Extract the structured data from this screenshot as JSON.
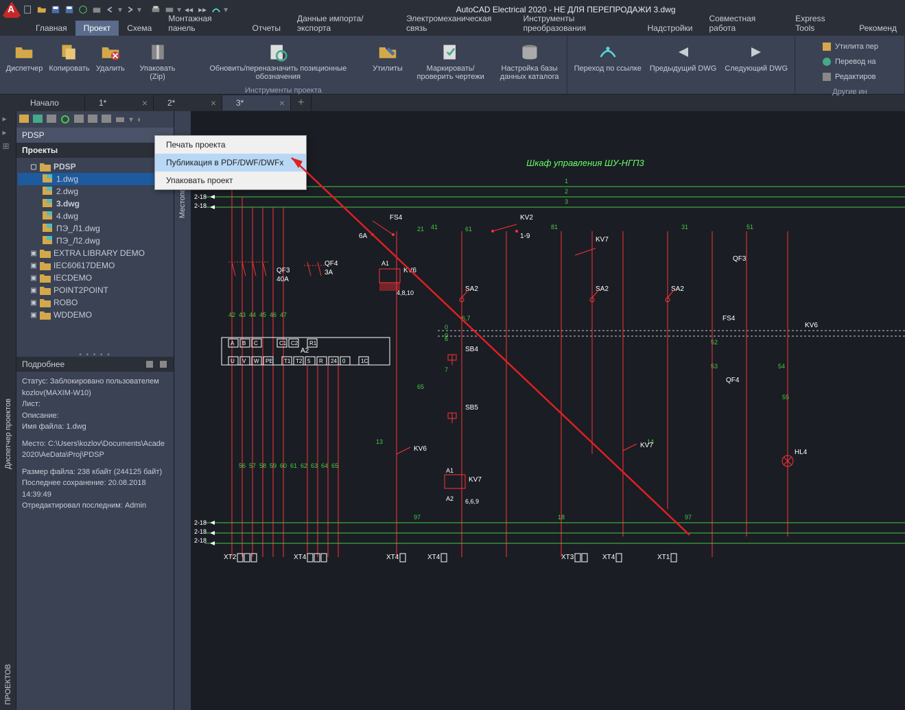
{
  "title": "AutoCAD Electrical 2020 - НЕ ДЛЯ ПЕРЕПРОДАЖИ   3.dwg",
  "ribbon_tabs": [
    "Главная",
    "Проект",
    "Схема",
    "Монтажная панель",
    "Отчеты",
    "Данные импорта/экспорта",
    "Электромеханическая связь",
    "Инструменты преобразования",
    "Надстройки",
    "Совместная работа",
    "Express Tools",
    "Рекоменд"
  ],
  "active_ribbon_tab": 1,
  "ribbon": {
    "dispetcher": "Диспетчер",
    "copy": "Копировать",
    "delete": "Удалить",
    "zip": "Упаковать (Zip)",
    "update": "Обновить/переназначить позиционные обозначения",
    "utilities": "Утилиты",
    "mark": "Маркировать/проверить чертежи",
    "catalog": "Настройка базы данных каталога",
    "goto_link": "Переход по ссылке",
    "prev_dwg": "Предыдущий DWG",
    "next_dwg": "Следующий DWG",
    "group1": "Инструменты проекта",
    "util_conv": "Утилита пер",
    "translate": "Перевод на",
    "edit_lang": "Редактиров",
    "other_group": "Другие ин"
  },
  "doc_tabs": [
    {
      "label": "Начало",
      "close": false
    },
    {
      "label": "1*",
      "close": true
    },
    {
      "label": "2*",
      "close": true
    },
    {
      "label": "3*",
      "close": true,
      "active": true
    }
  ],
  "project_panel": {
    "pdsp": "PDSP",
    "projects_header": "Проекты",
    "tree": {
      "root": "PDSP",
      "files": [
        "1.dwg",
        "2.dwg",
        "3.dwg",
        "4.dwg",
        "ПЭ_Л1.dwg",
        "ПЭ_Л2.dwg"
      ],
      "selected": 0,
      "bold": 2,
      "others": [
        "EXTRA LIBRARY DEMO",
        "IEC60617DEMO",
        "IECDEMO",
        "POINT2POINT",
        "ROBO",
        "WDDEMO"
      ]
    },
    "details_header": "Подробнее",
    "details": {
      "l1": "Статус: Заблокировано пользователем kozlov(MAXIM-W10)",
      "l2": "Лист:",
      "l3": "Описание:",
      "l4": "Имя файла: 1.dwg",
      "l5": "Место: C:\\Users\\kozlov\\Documents\\Acade 2020\\AeData\\Proj\\PDSP",
      "l6": "Размер файла: 238 кбайт (244125 байт)",
      "l7": "Последнее сохранение: 20.08.2018 14:39:49",
      "l8": "Отредактировал последним: Admin"
    }
  },
  "context_menu": {
    "items": [
      "Печать проекта",
      "Публикация в PDF/DWF/DWFx",
      "Упаковать проект"
    ],
    "highlighted": 1
  },
  "side_label_left": "Диспетчер проектов",
  "canvas_rail_label": "Местоположение",
  "side_label_bottom": "ПРОЕКТОВ",
  "canvas": {
    "title": "Шкаф управления ШУ-НГП3",
    "terminals_row1": [
      "A",
      "B",
      "C",
      "",
      "",
      "C1",
      "C2",
      "",
      "R1"
    ],
    "terminals_row2": [
      "U",
      "V",
      "W",
      "PE",
      "",
      "T1",
      "T2",
      "5",
      "R",
      "24",
      "0",
      "",
      "1C"
    ],
    "left_refs": [
      "2-18",
      "2-18",
      "2-18"
    ],
    "right_refs": [
      "2-18",
      "2-18",
      "2-18"
    ],
    "wire_nums_top": [
      "1",
      "21",
      "41",
      "61",
      "81",
      "31",
      "51"
    ],
    "wire_nums_mid": [
      "42",
      "43",
      "44",
      "45",
      "46",
      "47"
    ],
    "wire_nums_mid2": [
      "56",
      "57",
      "58",
      "59",
      "60",
      "61",
      "62",
      "63",
      "64",
      "65"
    ],
    "wire_nums_mid3": [
      "13",
      "6",
      "7",
      "52",
      "14",
      "53",
      "54",
      "55"
    ],
    "wire_nums_bot": [
      "97",
      "18",
      "97"
    ],
    "qf3": "QF3",
    "qf3_val": "40A",
    "qf4": "QF4",
    "qf4_val": "3A",
    "fs4": "FS4",
    "fs4_val": "6A",
    "kv2": "KV2",
    "kv2_val": "1-9",
    "kv6": "KV6",
    "kv6_ref": "4,8,10",
    "kv7": "KV7",
    "kv7_ref": "6,6,9",
    "a1": "A1",
    "a1b": "A2",
    "a2": "A2",
    "sa2": "SA2",
    "sb4": "SB4",
    "sb5": "SB5",
    "hl4": "HL4",
    "fs4r": "FS4",
    "qf3r": "QF3",
    "qf4r": "QF4",
    "kv6r": "KV6",
    "kv7r": "KV7",
    "xt1": "XT1",
    "xt2": "XT2",
    "xt3": "XT3",
    "xt4": "XT4",
    "xt4b": "XT4",
    "xt4c": "XT4"
  }
}
